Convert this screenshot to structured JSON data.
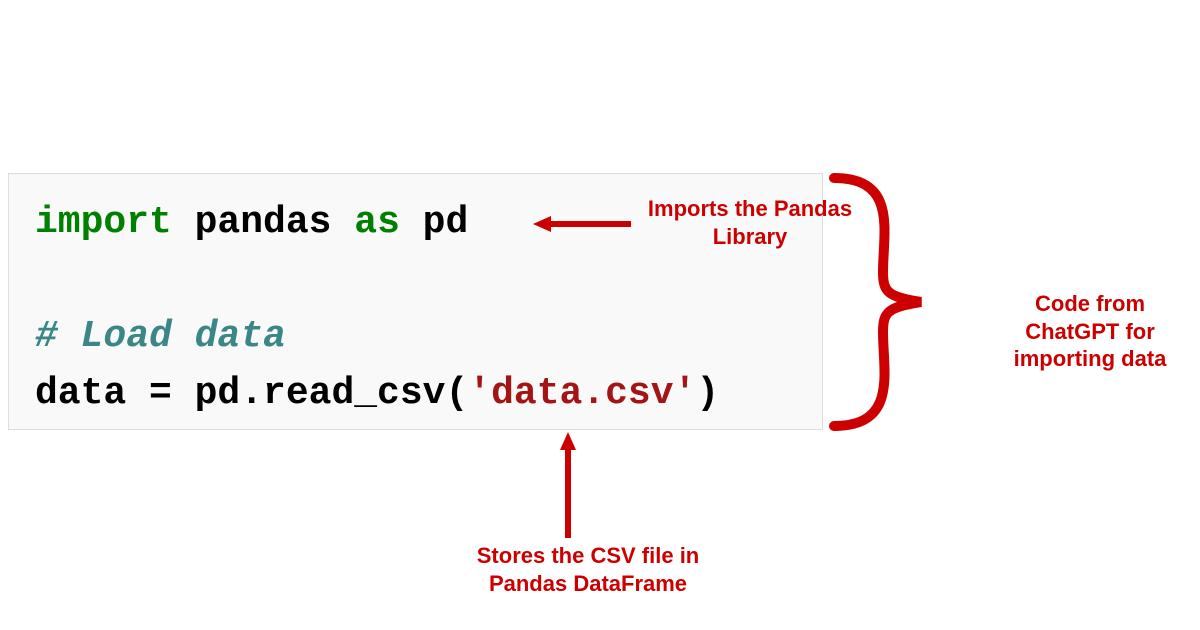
{
  "code": {
    "line1_import": "import",
    "line1_pandas": " pandas ",
    "line1_as": "as",
    "line1_pd": " pd",
    "line2_comment": "# Load data",
    "line3_prefix": "data = pd.read_csv(",
    "line3_string": "'data.csv'",
    "line3_suffix": ")"
  },
  "annotations": {
    "top": "Imports the Pandas Library",
    "right": "Code from ChatGPT for importing data",
    "bottom": "Stores the CSV file in Pandas DataFrame"
  }
}
